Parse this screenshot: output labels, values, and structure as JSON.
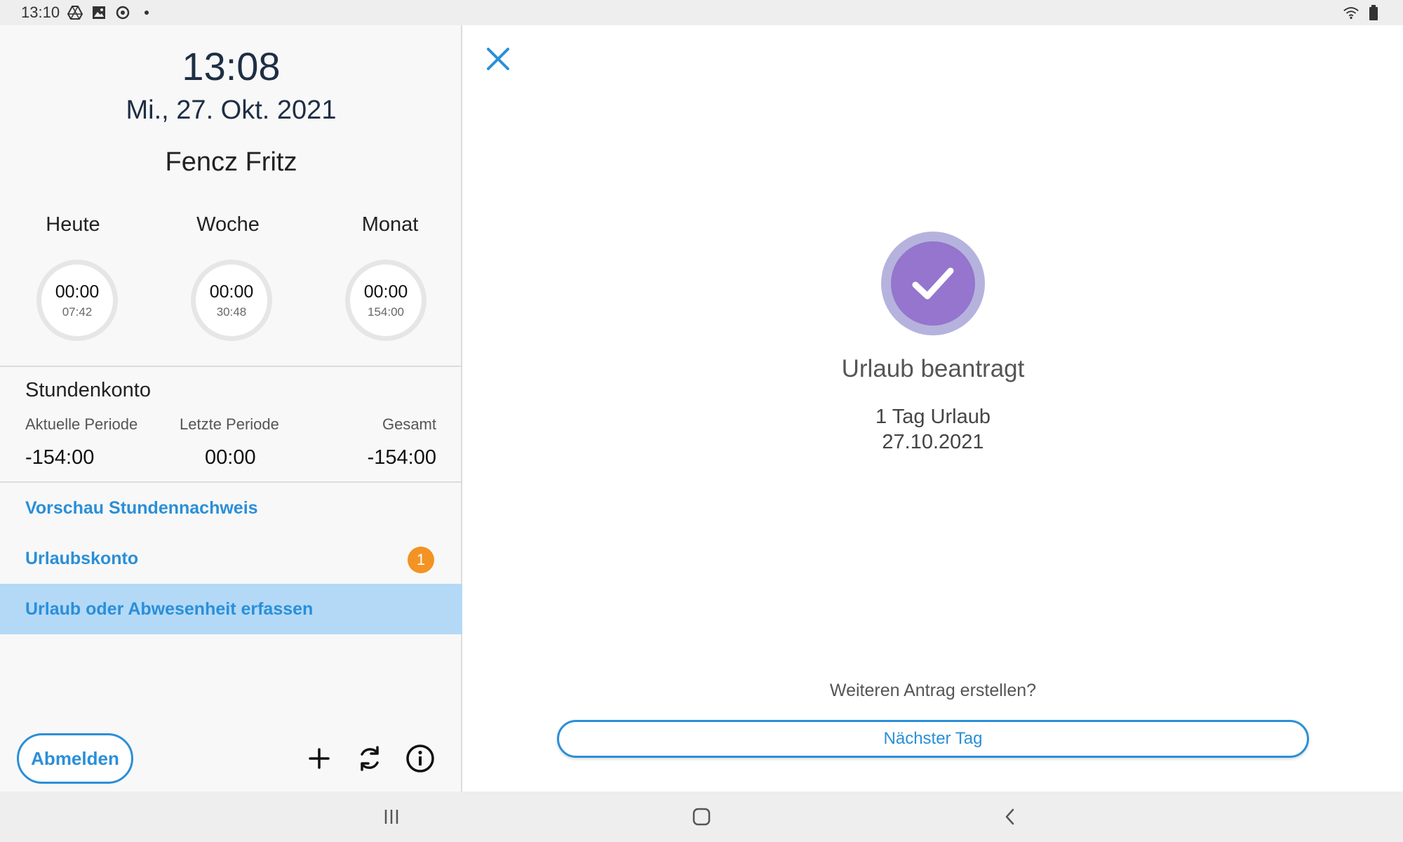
{
  "status_bar": {
    "time": "13:10",
    "left_icons": [
      "drive-icon",
      "image-icon",
      "sync-icon",
      "dot-icon"
    ],
    "right_icons": [
      "wifi-icon",
      "battery-icon"
    ]
  },
  "left_panel": {
    "clock": "13:08",
    "date": "Mi., 27. Okt. 2021",
    "user_name": "Fencz Fritz",
    "stats": [
      {
        "label": "Heute",
        "value": "00:00",
        "target": "07:42"
      },
      {
        "label": "Woche",
        "value": "00:00",
        "target": "30:48"
      },
      {
        "label": "Monat",
        "value": "00:00",
        "target": "154:00"
      }
    ],
    "account": {
      "title": "Stundenkonto",
      "columns": [
        {
          "label": "Aktuelle Periode",
          "value": "-154:00"
        },
        {
          "label": "Letzte Periode",
          "value": "00:00"
        },
        {
          "label": "Gesamt",
          "value": "-154:00"
        }
      ]
    },
    "menu": [
      {
        "label": "Vorschau Stundennachweis"
      },
      {
        "label": "Urlaubskonto",
        "badge": "1"
      },
      {
        "label": "Urlaub oder Abwesenheit erfassen",
        "active": true
      }
    ],
    "logout_label": "Abmelden",
    "toolbar_icons": [
      "plus-icon",
      "refresh-icon",
      "info-icon"
    ]
  },
  "right_panel": {
    "title": "Urlaub beantragt",
    "detail_line1": "1 Tag Urlaub",
    "detail_line2": "27.10.2021",
    "question": "Weiteren Antrag erstellen?",
    "next_day_label": "Nächster Tag"
  },
  "colors": {
    "accent": "#2a8fd8",
    "active_row": "#b3d9f7",
    "badge": "#f39323",
    "success_outer": "#b5b3dd",
    "success_inner": "#9575cd",
    "heading": "#1e2e44"
  },
  "nav_bar": {
    "icons": [
      "recent-apps-icon",
      "home-icon",
      "back-icon"
    ]
  }
}
